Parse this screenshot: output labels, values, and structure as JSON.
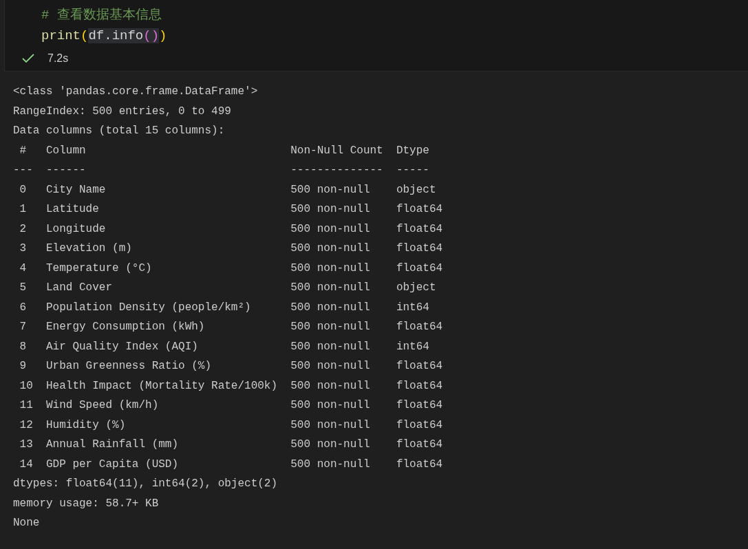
{
  "cell": {
    "code": [
      {
        "tokens": [
          {
            "text": "# 查看数据基本信息",
            "kind": "comment",
            "highlighted": false
          }
        ]
      },
      {
        "tokens": [
          {
            "text": "print",
            "kind": "function",
            "highlighted": false
          },
          {
            "text": "(",
            "kind": "bracket1",
            "highlighted": false
          },
          {
            "text": "df.info",
            "kind": "plain",
            "highlighted": true
          },
          {
            "text": "()",
            "kind": "bracket2",
            "highlighted": true
          },
          {
            "text": ")",
            "kind": "bracket1",
            "highlighted": false
          }
        ]
      }
    ],
    "succeeded": true,
    "duration": "7.2s"
  },
  "output": {
    "lines": [
      "<class 'pandas.core.frame.DataFrame'>",
      "RangeIndex: 500 entries, 0 to 499",
      "Data columns (total 15 columns):",
      " #   Column                               Non-Null Count  Dtype  ",
      "---  ------                               --------------  -----  ",
      " 0   City Name                            500 non-null    object ",
      " 1   Latitude                             500 non-null    float64",
      " 2   Longitude                            500 non-null    float64",
      " 3   Elevation (m)                        500 non-null    float64",
      " 4   Temperature (°C)                     500 non-null    float64",
      " 5   Land Cover                           500 non-null    object ",
      " 6   Population Density (people/km²)      500 non-null    int64  ",
      " 7   Energy Consumption (kWh)             500 non-null    float64",
      " 8   Air Quality Index (AQI)              500 non-null    int64  ",
      " 9   Urban Greenness Ratio (%)            500 non-null    float64",
      " 10  Health Impact (Mortality Rate/100k)  500 non-null    float64",
      " 11  Wind Speed (km/h)                    500 non-null    float64",
      " 12  Humidity (%)                         500 non-null    float64",
      " 13  Annual Rainfall (mm)                 500 non-null    float64",
      " 14  GDP per Capita (USD)                 500 non-null    float64",
      "dtypes: float64(11), int64(2), object(2)",
      "memory usage: 58.7+ KB",
      "None"
    ]
  }
}
